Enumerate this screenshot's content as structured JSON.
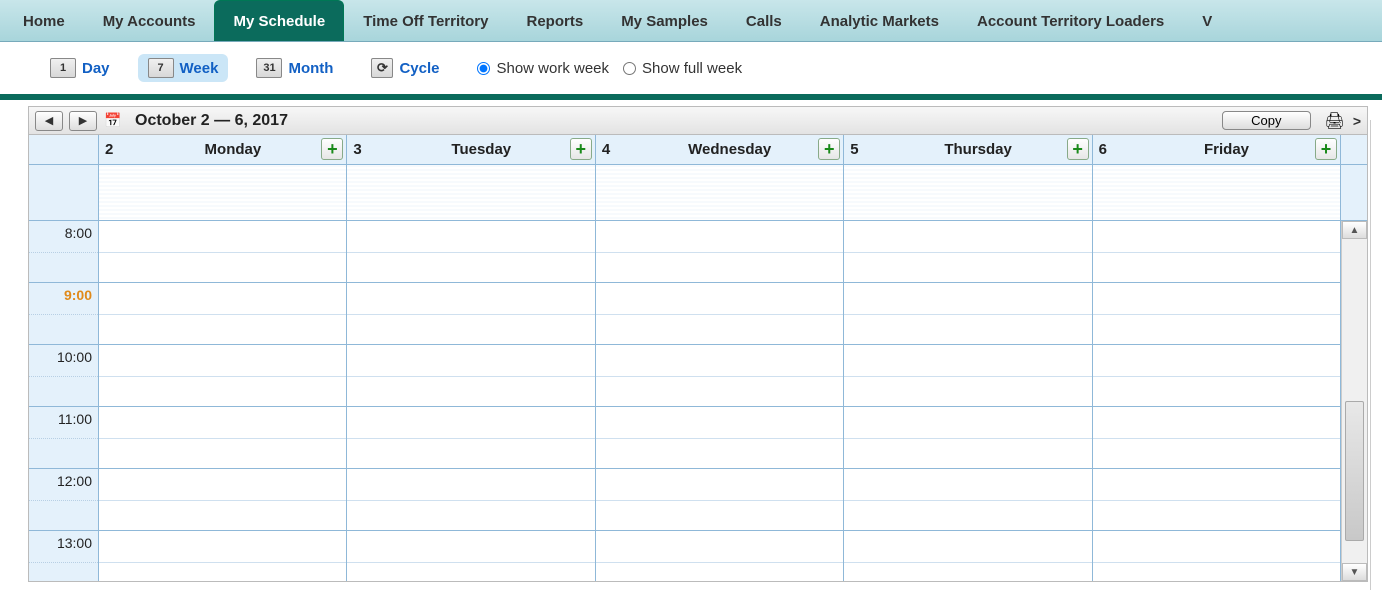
{
  "nav": {
    "tabs": [
      {
        "label": "Home"
      },
      {
        "label": "My Accounts"
      },
      {
        "label": "My Schedule"
      },
      {
        "label": "Time Off Territory"
      },
      {
        "label": "Reports"
      },
      {
        "label": "My Samples"
      },
      {
        "label": "Calls"
      },
      {
        "label": "Analytic Markets"
      },
      {
        "label": "Account Territory Loaders"
      },
      {
        "label": "V"
      }
    ],
    "active_index": 2
  },
  "views": {
    "day": {
      "num": "1",
      "label": "Day"
    },
    "week": {
      "num": "7",
      "label": "Week"
    },
    "month": {
      "num": "31",
      "label": "Month"
    },
    "cycle": {
      "label": "Cycle"
    },
    "active": "week"
  },
  "week_mode": {
    "work_label": "Show work week",
    "full_label": "Show full week",
    "selected": "work"
  },
  "calendar": {
    "date_range": "October 2 — 6, 2017",
    "copy_label": "Copy",
    "days": [
      {
        "num": "2",
        "name": "Monday"
      },
      {
        "num": "3",
        "name": "Tuesday"
      },
      {
        "num": "4",
        "name": "Wednesday"
      },
      {
        "num": "5",
        "name": "Thursday"
      },
      {
        "num": "6",
        "name": "Friday"
      }
    ],
    "hours": [
      {
        "label": "8:00",
        "now": false
      },
      {
        "label": "9:00",
        "now": true
      },
      {
        "label": "10:00",
        "now": false
      },
      {
        "label": "11:00",
        "now": false
      },
      {
        "label": "12:00",
        "now": false
      },
      {
        "label": "13:00",
        "now": false
      }
    ]
  }
}
